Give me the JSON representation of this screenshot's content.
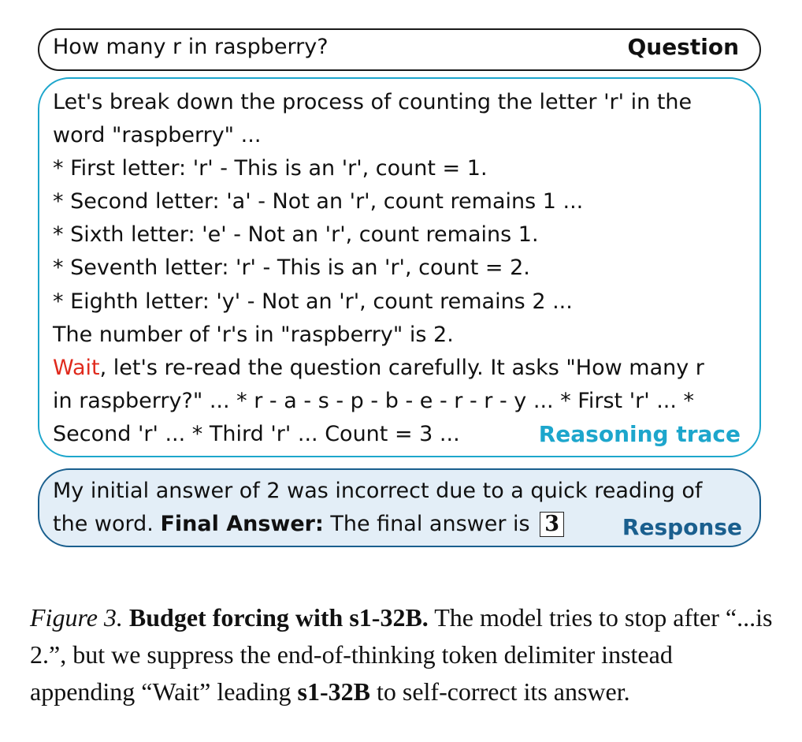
{
  "question": {
    "text": "How many r in raspberry?",
    "tag": "Question"
  },
  "reasoning": {
    "tag": "Reasoning trace",
    "lines": [
      "Let's break down the process of counting the letter 'r' in the",
      "word \"raspberry\" ...",
      "* First letter: 'r' - This is an 'r', count = 1.",
      "* Second letter: 'a' - Not an 'r', count remains 1 ...",
      "* Sixth letter: 'e' - Not an 'r', count remains 1.",
      "* Seventh letter: 'r' - This is an 'r', count = 2.",
      "* Eighth letter: 'y' - Not an 'r', count remains 2 ...",
      "The number of 'r's in \"raspberry\" is 2."
    ],
    "wait_word": "Wait",
    "wait_rest": ", let's re-read the question carefully. It asks \"How many r",
    "line_10": "in raspberry?\" ... * r - a - s - p - b - e - r - r - y ... * First 'r' ... *",
    "line_11": "Second 'r' ... * Third 'r' ... Count = 3 ..."
  },
  "response": {
    "tag": "Response",
    "line_1": "My initial answer of 2 was incorrect due to a quick reading of",
    "line_2_start": "the word. ",
    "final_label": "Final Answer:",
    "final_text": " The final answer is ",
    "answer": "3"
  },
  "caption": {
    "figure_label": "Figure 3.",
    "bold_title": "Budget forcing with s1-32B.",
    "text_1": " The model tries to stop after “...is 2.”, but we suppress the end-of-thinking token delimiter instead appending “Wait” leading ",
    "bold_model": "s1-32B",
    "text_2": " to self-correct its answer."
  },
  "colors": {
    "question_border": "#1a1a1a",
    "reasoning_accent": "#1da6cc",
    "response_accent": "#1a5f8e",
    "response_fill": "#e3eef7",
    "wait_color": "#e02a1d"
  }
}
